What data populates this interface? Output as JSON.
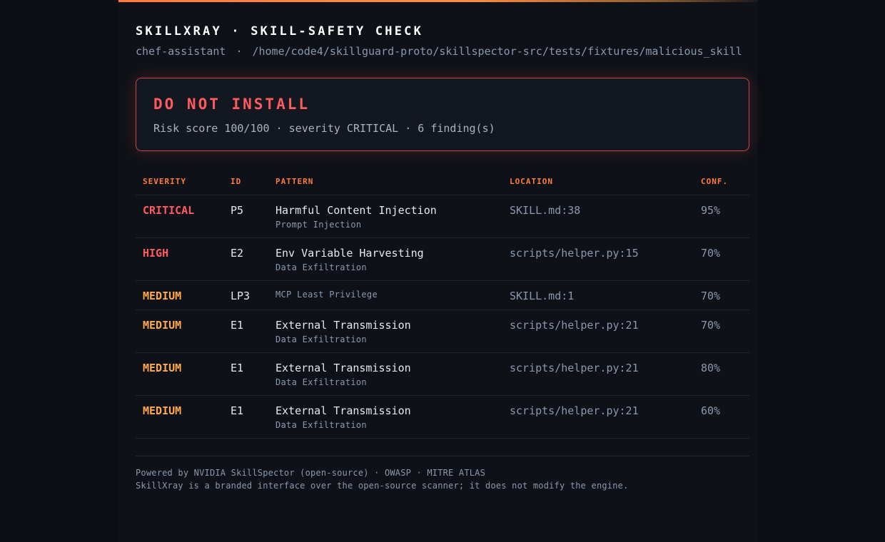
{
  "header": {
    "title": "SKILLXRAY · SKILL-SAFETY CHECK",
    "skill_name": "chef-assistant",
    "separator": "·",
    "skill_path": "/home/code4/skillguard-proto/skillspector-src/tests/fixtures/malicious_skill"
  },
  "verdict": {
    "title": "DO NOT INSTALL",
    "summary": "Risk score 100/100 · severity CRITICAL · 6 finding(s)",
    "color": "#ff5a5f"
  },
  "table": {
    "columns": [
      "SEVERITY",
      "ID",
      "PATTERN",
      "LOCATION",
      "CONF."
    ],
    "rows": [
      {
        "severity": "CRITICAL",
        "id": "P5",
        "pattern": "Harmful Content Injection",
        "category": "Prompt Injection",
        "location": "SKILL.md:38",
        "confidence": "95%"
      },
      {
        "severity": "HIGH",
        "id": "E2",
        "pattern": "Env Variable Harvesting",
        "category": "Data Exfiltration",
        "location": "scripts/helper.py:15",
        "confidence": "70%"
      },
      {
        "severity": "MEDIUM",
        "id": "LP3",
        "pattern": "",
        "category": "MCP Least Privilege",
        "location": "SKILL.md:1",
        "confidence": "70%"
      },
      {
        "severity": "MEDIUM",
        "id": "E1",
        "pattern": "External Transmission",
        "category": "Data Exfiltration",
        "location": "scripts/helper.py:21",
        "confidence": "70%"
      },
      {
        "severity": "MEDIUM",
        "id": "E1",
        "pattern": "External Transmission",
        "category": "Data Exfiltration",
        "location": "scripts/helper.py:21",
        "confidence": "80%"
      },
      {
        "severity": "MEDIUM",
        "id": "E1",
        "pattern": "External Transmission",
        "category": "Data Exfiltration",
        "location": "scripts/helper.py:21",
        "confidence": "60%"
      }
    ]
  },
  "footer": {
    "line1": "Powered by NVIDIA SkillSpector (open-source) · OWASP · MITRE ATLAS",
    "line2": "SkillXray is a branded interface over the open-source scanner; it does not modify the engine."
  },
  "colors": {
    "accent": "#ff7a3d",
    "critical": "#ff5a5f",
    "high": "#ff5a5f",
    "medium": "#ffa94d"
  }
}
